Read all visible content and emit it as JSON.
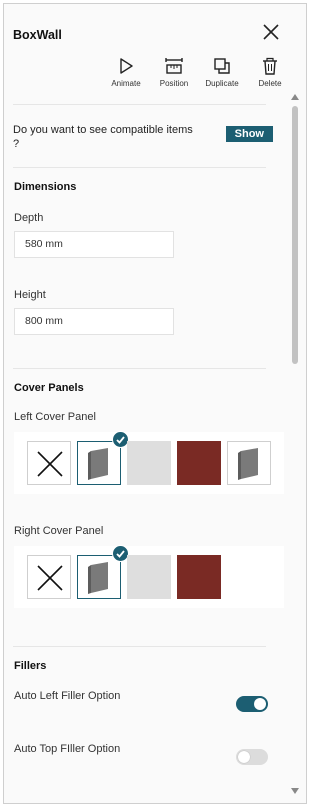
{
  "header": {
    "title": "BoxWall",
    "toolbar": [
      {
        "label": "Animate",
        "icon": "play-icon"
      },
      {
        "label": "Position",
        "icon": "position-icon"
      },
      {
        "label": "Duplicate",
        "icon": "duplicate-icon"
      },
      {
        "label": "Delete",
        "icon": "trash-icon"
      }
    ]
  },
  "compatible": {
    "question": "Do you want to see compatible items ?",
    "button": "Show"
  },
  "dimensions": {
    "title": "Dimensions",
    "depth_label": "Depth",
    "depth_value": "580 mm",
    "height_label": "Height",
    "height_value": "800 mm"
  },
  "cover_panels": {
    "title": "Cover Panels",
    "left_label": "Left Cover Panel",
    "right_label": "Right Cover Panel"
  },
  "fillers": {
    "title": "Fillers",
    "auto_left_label": "Auto Left Filler Option",
    "auto_left_on": true,
    "auto_top_label": "Auto Top FIller Option",
    "auto_top_on": false
  },
  "colors": {
    "accent": "#1c5e72",
    "panel_red": "#7a2a24",
    "panel_grey": "#dedede"
  }
}
